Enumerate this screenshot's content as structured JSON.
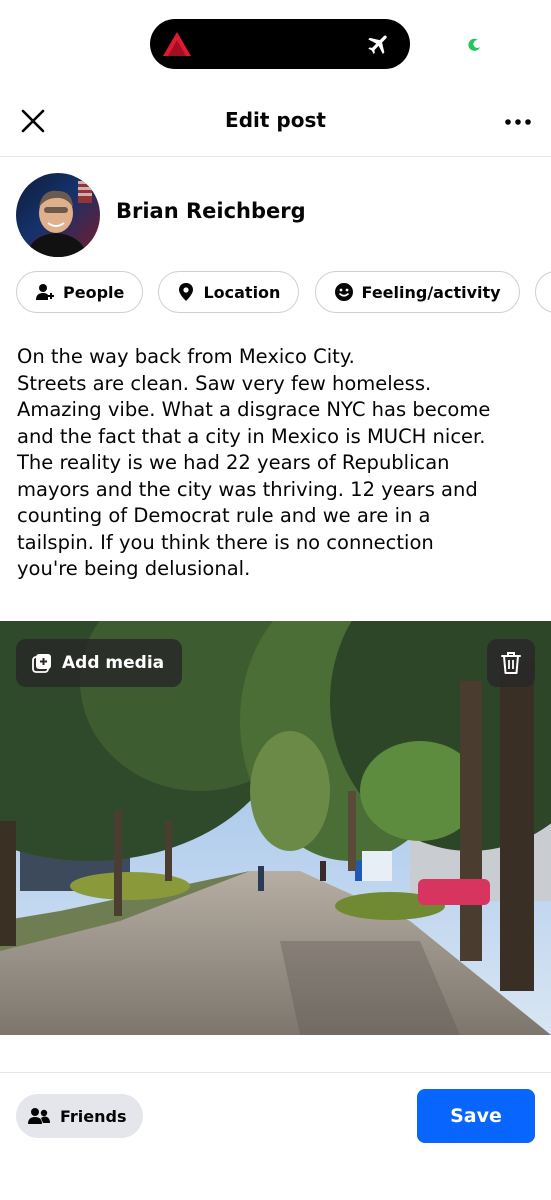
{
  "header": {
    "title": "Edit post"
  },
  "author": {
    "name": "Brian Reichberg"
  },
  "chips": [
    {
      "label": "People",
      "icon": "person-add-icon"
    },
    {
      "label": "Location",
      "icon": "location-pin-icon"
    },
    {
      "label": "Feeling/activity",
      "icon": "smiley-icon"
    }
  ],
  "post": {
    "text": "On the way back from Mexico City.\nStreets are clean. Saw very few homeless.\nAmazing vibe. What a disgrace NYC has become\nand the fact that a city in Mexico is MUCH nicer.\nThe reality is we had 22 years of Republican\nmayors and the city was thriving. 12 years and\ncounting of Democrat rule and we are in a\ntailspin. If you think there is no connection\nyou're being delusional."
  },
  "media": {
    "add_label": "Add media"
  },
  "footer": {
    "audience_label": "Friends",
    "save_label": "Save"
  },
  "colors": {
    "accent": "#0866ff",
    "chip_border": "#ced0d4",
    "audience_bg": "#e4e6eb"
  }
}
